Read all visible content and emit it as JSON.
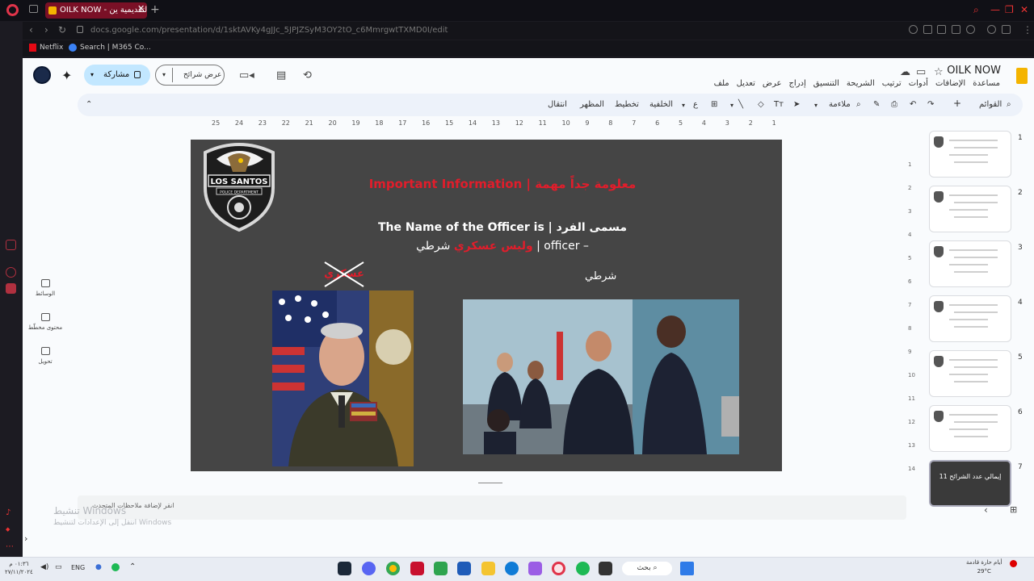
{
  "browser": {
    "tab_title": "OILK NOW - من التقديمية ين",
    "url": "docs.google.com/presentation/d/1sktAVKy4gJJc_5JPJZSyM3OY2tO_c6MmrgwtTXMD0I/edit",
    "bookmarks": [
      "Netflix",
      "Search | M365 Co..."
    ]
  },
  "docs": {
    "title": "OILK NOW",
    "menu": [
      "ملف",
      "تعديل",
      "عرض",
      "إدراج",
      "التنسيق",
      "الشريحة",
      "ترتيب",
      "أدوات",
      "الإضافات",
      "مساعدة"
    ],
    "share_label": "مشاركة",
    "slideshow_label": "عرض شرائح",
    "toolbar": {
      "menus_label": "القوائم",
      "fit_label": "ملاءمة",
      "background": "الخلفية",
      "layout": "تخطيط",
      "theme": "المظهر",
      "transition": "انتقال"
    },
    "left_panel": [
      "الوسائط",
      "محتوى مخطّط",
      "تحويل"
    ],
    "notes_placeholder": "انقر لإضافة ملاحظات المتحدث",
    "activate_title": "تنشيط Windows",
    "activate_sub": "انتقل إلى الإعدادات لتنشيط Windows",
    "ruler_top": [
      "25",
      "24",
      "23",
      "22",
      "21",
      "20",
      "19",
      "18",
      "17",
      "16",
      "15",
      "14",
      "13",
      "12",
      "11",
      "10",
      "9",
      "8",
      "7",
      "6",
      "5",
      "4",
      "3",
      "2",
      "1"
    ],
    "ruler_side": [
      "1",
      "2",
      "3",
      "4",
      "5",
      "6",
      "7",
      "8",
      "9",
      "10",
      "11",
      "12",
      "13",
      "14"
    ],
    "slide_numbers": [
      "1",
      "2",
      "3",
      "4",
      "5",
      "6",
      "7"
    ],
    "slide7_thumb_text": "إيمالي عدد الشرائح 11"
  },
  "slide": {
    "badge_top": "LOS SANTOS",
    "badge_sub": "POLICE DEPARTMENT",
    "title": "Important Information | معلومة جداً مهمة",
    "officer_name": "The Name of the Officer is | مسمى الفرد",
    "role_prefix": "شرطي | officer –",
    "role_red": "وليس عسكري",
    "crossed_word": "عسكري",
    "police_label": "شرطي"
  },
  "taskbar": {
    "search": "بحث",
    "lang": "ENG",
    "time": "٠١:٣٦ م",
    "date": "٢٧/١١/٢٠٢٤",
    "weather": "أيام حارة قادمة",
    "temp": "29°C"
  },
  "colors": {
    "slide_bg": "#454545",
    "accent_red": "#e11d2b",
    "share_bg": "#c2e7ff",
    "tab_bg": "#7a1026"
  }
}
